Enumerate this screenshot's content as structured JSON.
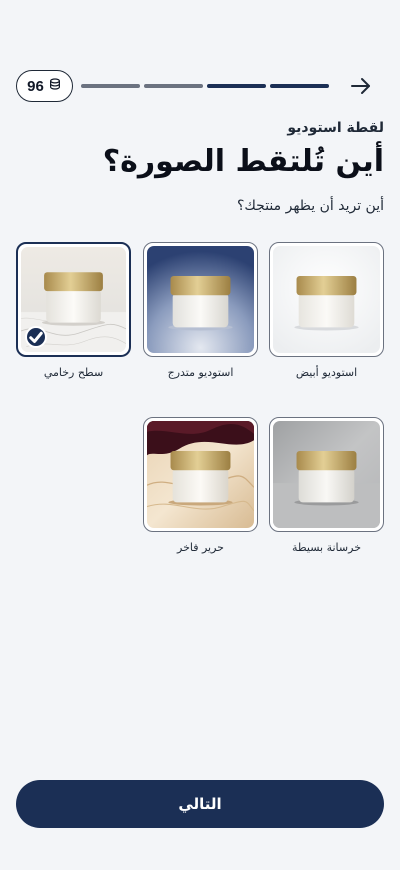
{
  "header": {
    "credits": "96",
    "progress_total_segments": 4,
    "progress_completed_segments": 2,
    "back_icon": "arrow-right-icon",
    "credits_icon": "coins-icon"
  },
  "step": {
    "label": "لقطة استوديو",
    "title": "أين تُلتقط الصورة؟",
    "subtitle": "أين تريد أن يظهر منتجك؟"
  },
  "options": [
    {
      "label": "استوديو أبيض",
      "selected": false
    },
    {
      "label": "استوديو متدرج",
      "selected": false
    },
    {
      "label": "سطح رخامي",
      "selected": true
    },
    {
      "label": "خرسانة بسيطة",
      "selected": false
    },
    {
      "label": "حرير فاخر",
      "selected": false
    }
  ],
  "footer": {
    "next_label": "التالي"
  },
  "colors": {
    "primary": "#1b2f55",
    "background": "#f3f5f8"
  }
}
